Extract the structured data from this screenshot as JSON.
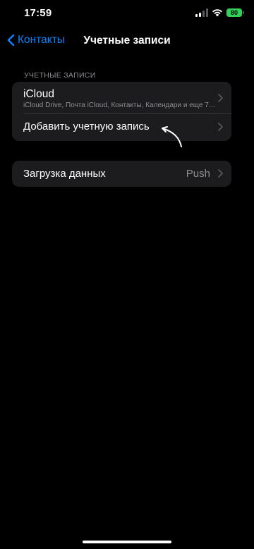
{
  "status_bar": {
    "time": "17:59",
    "battery_level": "80",
    "battery_color": "#30d158",
    "signal_bars_active": 2,
    "signal_bars_total": 4
  },
  "nav": {
    "back_label": "Контакты",
    "title": "Учетные записи",
    "accent_color": "#0a84ff"
  },
  "accounts_section": {
    "header": "УЧЕТНЫЕ ЗАПИСИ",
    "rows": [
      {
        "title": "iCloud",
        "subtitle": "iCloud Drive, Почта iCloud, Контакты, Календари и еще 7…"
      },
      {
        "title": "Добавить учетную запись"
      }
    ]
  },
  "fetch_section": {
    "title": "Загрузка данных",
    "value": "Push"
  },
  "icons": {
    "back": "chevron-left-icon",
    "disclosure": "chevron-right-icon",
    "wifi": "wifi-icon",
    "signal": "cellular-signal-icon",
    "battery": "battery-icon",
    "pointer": "annotation-arrow-icon"
  }
}
